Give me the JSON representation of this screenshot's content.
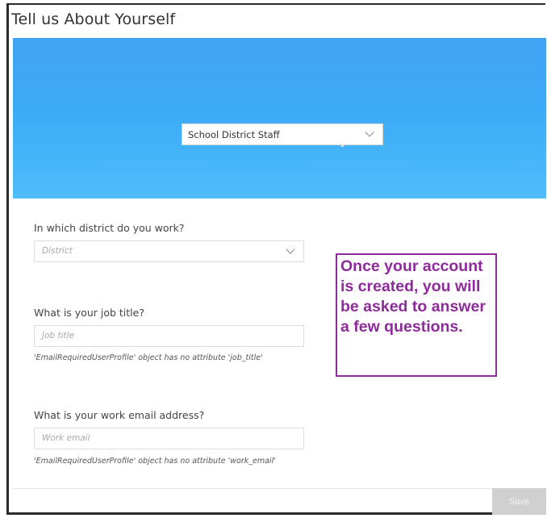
{
  "dialog": {
    "title": "Tell us About Yourself"
  },
  "hero": {
    "question": "Which best describes you?",
    "role_select_value": "School District Staff"
  },
  "form": {
    "district": {
      "label": "In which district do you work?",
      "placeholder": "District"
    },
    "job_title": {
      "label": "What is your job title?",
      "placeholder": "Job title",
      "error": "'EmailRequiredUserProfile' object has no attribute 'job_title'"
    },
    "work_email": {
      "label": "What is your work email address?",
      "placeholder": "Work email",
      "error": "'EmailRequiredUserProfile' object has no attribute 'work_email'"
    }
  },
  "callout": {
    "text": "Once your account is created, you will be asked to answer a few questions."
  },
  "footer": {
    "save_label": "Save"
  },
  "colors": {
    "hero_blue": "#42a3f5",
    "callout_purple": "#8e2b9b",
    "save_disabled": "#d0d0d0"
  }
}
